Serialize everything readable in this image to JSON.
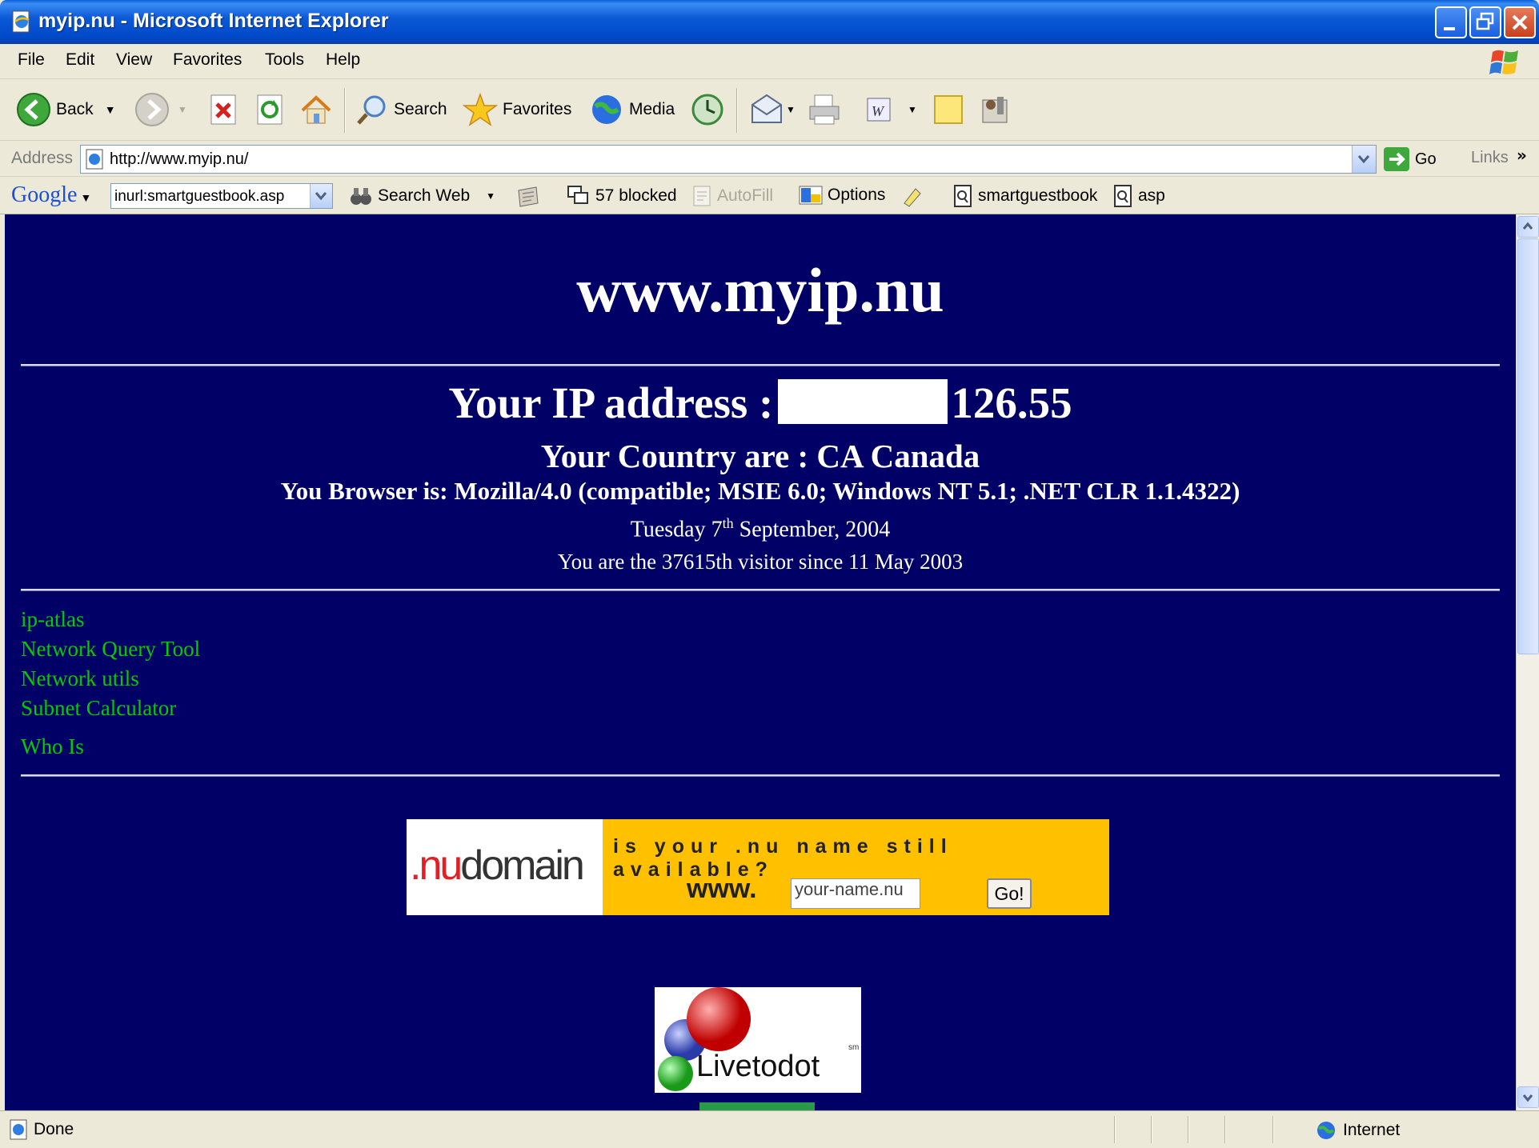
{
  "window": {
    "title": "myip.nu - Microsoft Internet Explorer"
  },
  "menu": {
    "items": [
      "File",
      "Edit",
      "View",
      "Favorites",
      "Tools",
      "Help"
    ]
  },
  "toolbar": {
    "back_label": "Back",
    "search_label": "Search",
    "favorites_label": "Favorites",
    "media_label": "Media"
  },
  "address_bar": {
    "label": "Address",
    "url": "http://www.myip.nu/",
    "go_label": "Go",
    "links_label": "Links"
  },
  "google_toolbar": {
    "logo": "Google",
    "query": "inurl:smartguestbook.asp",
    "search_web_label": "Search Web",
    "blocked_label": "57 blocked",
    "autofill_label": "AutoFill",
    "options_label": "Options",
    "term1": "smartguestbook",
    "term2": "asp"
  },
  "page": {
    "site_title": "www.myip.nu",
    "ip_label": "Your IP address :",
    "ip_visible_suffix": "126.55",
    "country": "Your Country are : CA Canada",
    "browser": "You Browser is: Mozilla/4.0 (compatible; MSIE 6.0; Windows NT 5.1; .NET CLR 1.1.4322)",
    "date_prefix": "Tuesday 7",
    "date_sup": "th",
    "date_suffix": " September, 2004",
    "visitor_line": "You are the 37615th visitor since 11 May 2003",
    "links": [
      "ip-atlas",
      "Network Query Tool",
      "Network utils",
      "Subnet Calculator",
      "Who Is"
    ]
  },
  "banner": {
    "logo_nu": ".nu",
    "logo_domain": "domain",
    "tagline": "is your .nu name still available?",
    "www_label": "www.",
    "input_value": "your-name.nu",
    "go_button": "Go!"
  },
  "livetodot": {
    "text": "Livetodot",
    "mark": "sm"
  },
  "statusbar": {
    "status": "Done",
    "zone": "Internet"
  },
  "colors": {
    "page_background": "#000066",
    "link_color": "#00cc00",
    "banner_yellow": "#ffc000",
    "titlebar_blue": "#0048c8"
  }
}
